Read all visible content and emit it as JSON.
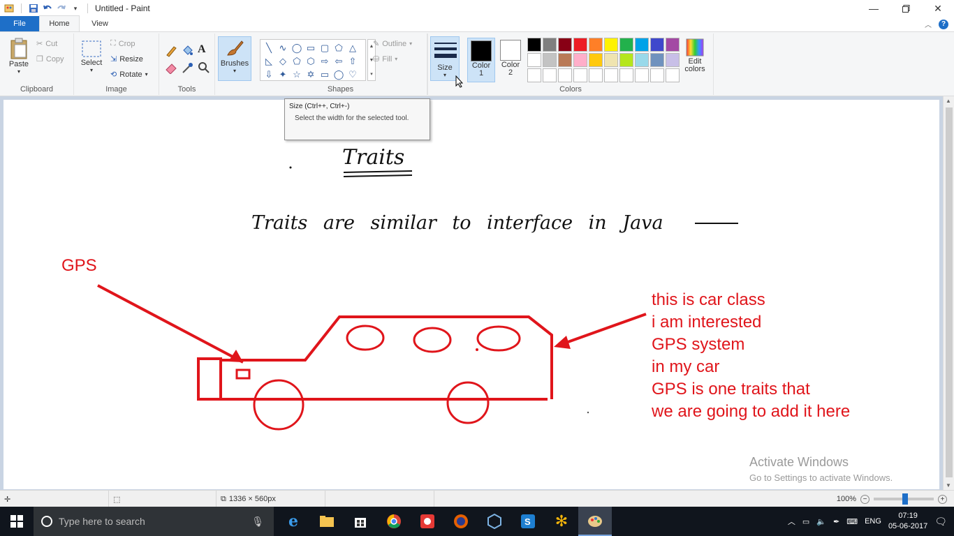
{
  "window": {
    "title": "Untitled - Paint",
    "min_icon": "minimize-icon",
    "max_icon": "restore-icon",
    "close_icon": "close-icon"
  },
  "tabs": {
    "file": "File",
    "home": "Home",
    "view": "View"
  },
  "clipboard": {
    "paste": "Paste",
    "cut": "Cut",
    "copy": "Copy",
    "group": "Clipboard"
  },
  "image": {
    "select": "Select",
    "crop": "Crop",
    "resize": "Resize",
    "rotate": "Rotate",
    "group": "Image"
  },
  "tools": {
    "group": "Tools",
    "brushes": "Brushes"
  },
  "shapes": {
    "outline": "Outline",
    "fill": "Fill",
    "group": "Shapes"
  },
  "size": {
    "label": "Size"
  },
  "colors": {
    "color1": "Color",
    "color1_num": "1",
    "color2": "Color",
    "color2_num": "2",
    "edit": "Edit",
    "edit2": "colors",
    "group": "Colors",
    "color1_value": "#000000",
    "color2_value": "#ffffff",
    "palette": [
      "#000000",
      "#7f7f7f",
      "#880015",
      "#ed1c24",
      "#ff7f27",
      "#fff200",
      "#22b14c",
      "#00a2e8",
      "#3f48cc",
      "#a349a4",
      "#ffffff",
      "#c3c3c3",
      "#b97a57",
      "#ffaec9",
      "#ffc90e",
      "#efe4b0",
      "#b5e61d",
      "#99d9ea",
      "#7092be",
      "#c8bfe7",
      "#ffffff",
      "#ffffff",
      "#ffffff",
      "#ffffff",
      "#ffffff",
      "#ffffff",
      "#ffffff",
      "#ffffff",
      "#ffffff",
      "#ffffff"
    ]
  },
  "tooltip": {
    "title": "Size (Ctrl++, Ctrl+-)",
    "body": "Select the width for the selected tool."
  },
  "canvas": {
    "heading": "Traits",
    "sentence": "Traits are similar to interface in Java",
    "gps_label": "GPS",
    "note_lines": [
      "this is car class",
      "i am interested",
      "GPS system",
      "in my car",
      "GPS is one traits that",
      "we are going to add it here"
    ],
    "accent": "#e0151b"
  },
  "watermark": {
    "line1": "Activate Windows",
    "line2": "Go to Settings to activate Windows."
  },
  "status": {
    "dimensions": "1336 × 560px",
    "zoom": "100%",
    "zoom_level_percent": 100
  },
  "taskbar": {
    "search_placeholder": "Type here to search",
    "lang": "ENG",
    "time": "07:19",
    "date": "05-06-2017"
  }
}
